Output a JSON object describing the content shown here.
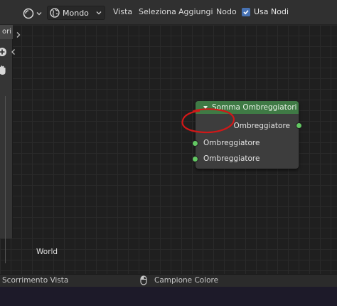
{
  "header": {
    "editor_type_icon": "node-editor-icon",
    "world_dropdown": {
      "icon": "world-icon",
      "label": "Mondo"
    },
    "menus": [
      "Vista",
      "Seleziona",
      "Aggiungi",
      "Nodo"
    ],
    "use_nodes": {
      "label": "Usa Nodi",
      "checked": true
    }
  },
  "sidebar": {
    "tab_label": "ori"
  },
  "node": {
    "title": "Somma Ombreggiatori",
    "output_label": "Ombreggiatore",
    "input_labels": [
      "Ombreggiatore",
      "Ombreggiatore"
    ],
    "header_color": "#3f7a45",
    "socket_color": "#63c763"
  },
  "annotation": {
    "color": "#d01818"
  },
  "canvas": {
    "context_label": "World"
  },
  "statusbar": {
    "left_text": "Scorrimento Vista",
    "right_text": "Campione Colore"
  }
}
